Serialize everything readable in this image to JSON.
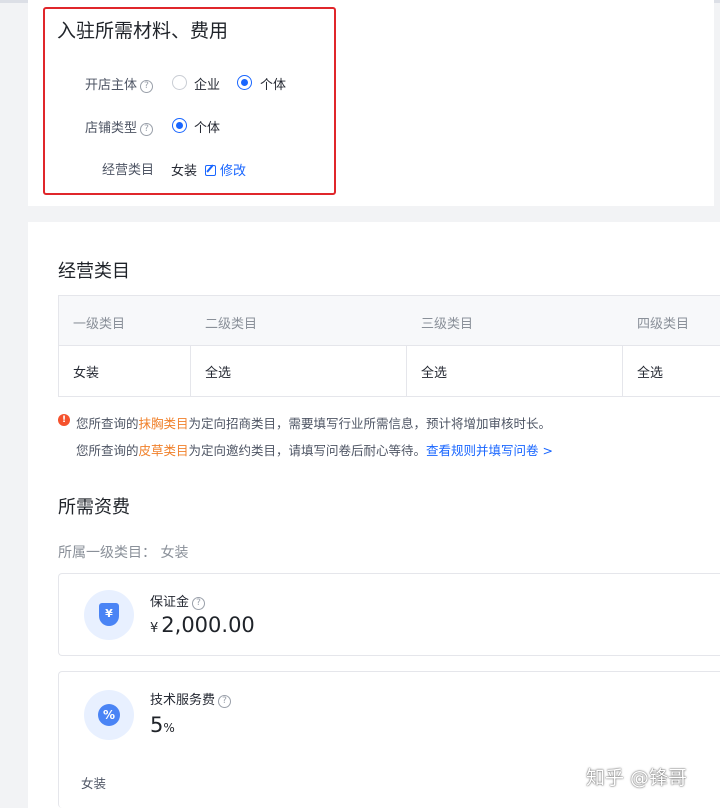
{
  "entry": {
    "title": "入驻所需材料、费用",
    "store_subject_label": "开店主体",
    "store_subject_options": [
      "企业",
      "个体"
    ],
    "store_subject_selected": "个体",
    "store_type_label": "店铺类型",
    "store_type_options": [
      "个体"
    ],
    "business_category_label": "经营类目",
    "business_category_value": "女装",
    "edit_label": "修改"
  },
  "categories": {
    "title": "经营类目",
    "headers": [
      "一级类目",
      "二级类目",
      "三级类目",
      "四级类目"
    ],
    "row": [
      "女装",
      "全选",
      "全选",
      "全选"
    ]
  },
  "notices": {
    "line1_prefix": "您所查询的",
    "line1_highlight": "抹胸类目",
    "line1_suffix": "为定向招商类目，需要填写行业所需信息，预计将增加审核时长。",
    "line2_prefix": "您所查询的",
    "line2_highlight": "皮草类目",
    "line2_suffix": "为定向邀约类目，请填写问卷后耐心等待。",
    "line2_link": "查看规则并填写问卷 >"
  },
  "fees": {
    "title": "所需资费",
    "subtitle": "所属一级类目：  女装",
    "deposit_label": "保证金",
    "deposit_currency": "¥",
    "deposit_value": "2,000.00",
    "service_fee_label": "技术服务费",
    "service_fee_value": "5",
    "service_fee_unit": "%",
    "service_fee_category": "女装"
  },
  "watermark": "知乎 @锋哥",
  "colors": {
    "accent": "#1966ff",
    "highlight_border": "#e0262b",
    "warning": "#f5522d",
    "orange_text": "#f0802a"
  }
}
